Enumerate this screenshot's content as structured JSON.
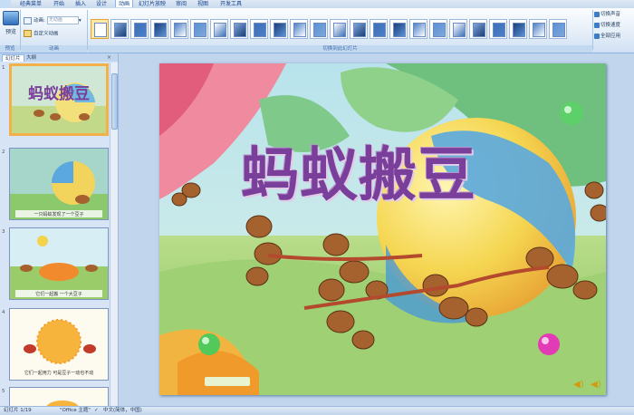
{
  "ribbon_tabs": [
    "经典菜单",
    "开始",
    "插入",
    "设计",
    "动画",
    "幻灯片放映",
    "审阅",
    "视图",
    "开发工具"
  ],
  "active_tab_index": 4,
  "preview_group": {
    "button_label": "预览",
    "group_label": "预览"
  },
  "animation_group": {
    "animate_label": "动画:",
    "animate_value": "无动画",
    "custom_label": "自定义动画",
    "group_label": "动画"
  },
  "transition_group": {
    "group_label": "切换到此幻灯片",
    "thumbnail_count": 24
  },
  "right_options": {
    "sound_label": "切换声音",
    "speed_label": "切换速度",
    "apply_all_label": "全部应用"
  },
  "left_panel": {
    "tabs": [
      "幻灯片",
      "大纲"
    ],
    "close_glyph": "×",
    "slide_numbers": [
      "1",
      "2",
      "3",
      "4",
      "5"
    ],
    "slide2_caption": "一只蚂蚁发现了一个豆子",
    "slide3_caption": "它们一起搬 一个大豆子",
    "slide4_caption": "它们一起用力 可是豆子一动也不动"
  },
  "slide": {
    "title": "蚂蚁搬豆"
  },
  "status": {
    "slide_info": "幻灯片 1/19",
    "theme": "\"Office 主题\"",
    "language": "中文(简体，中国)"
  },
  "colors": {
    "title_purple": "#7a3f9a",
    "selected_border": "#f2b04b"
  }
}
